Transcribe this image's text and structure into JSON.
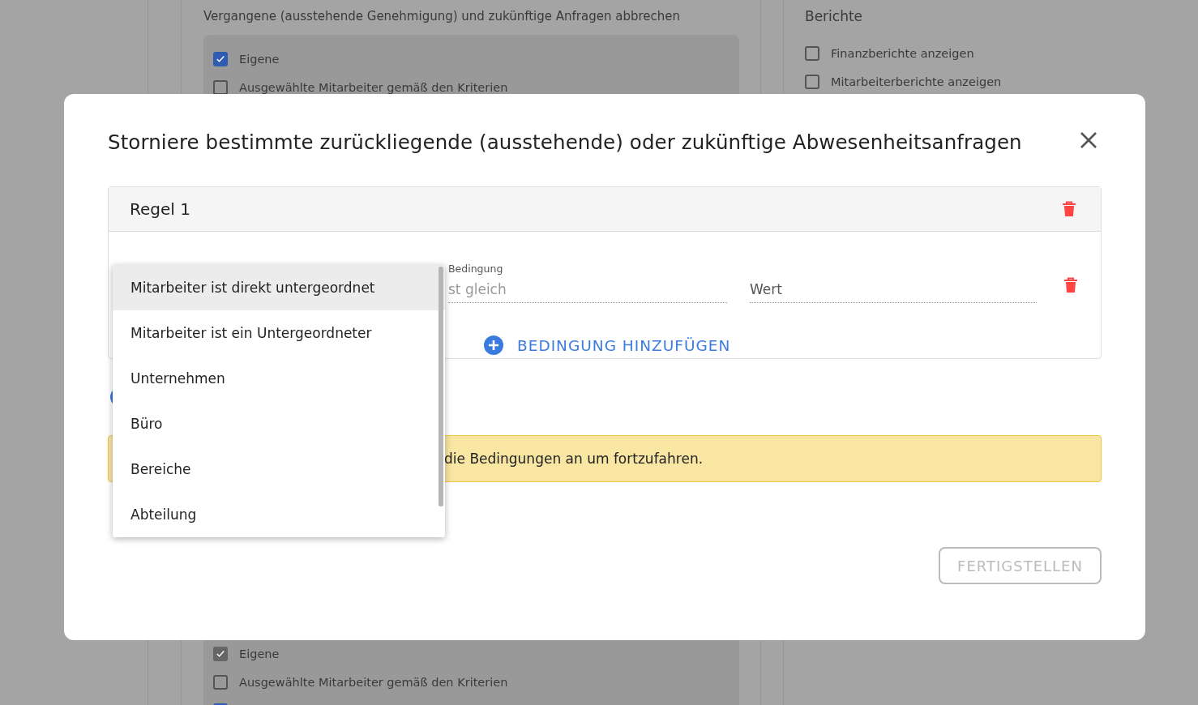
{
  "background": {
    "permissions": {
      "title": "Vergangene (ausstehende Genehmigung) und zukünftige Anfragen abbrechen",
      "options": [
        {
          "label": "Eigene",
          "checked": true,
          "disabled": false
        },
        {
          "label": "Ausgewählte Mitarbeiter gemäß den Kriterien",
          "checked": false,
          "disabled": false
        }
      ]
    },
    "reports": {
      "title": "Berichte",
      "options": [
        {
          "label": "Finanzberichte anzeigen",
          "checked": false
        },
        {
          "label": "Mitarbeiterberichte anzeigen",
          "checked": false
        }
      ]
    },
    "lower_options": [
      {
        "label": "Eigene",
        "checked": true,
        "disabled": true
      },
      {
        "label": "Ausgewählte Mitarbeiter gemäß den Kriterien",
        "checked": false,
        "disabled": false
      },
      {
        "checked": true,
        "disabled": false
      }
    ]
  },
  "dialog": {
    "title": "Storniere bestimmte zurückliegende (ausstehende) oder zukünftige Abwesenheitsanfragen",
    "rules": [
      {
        "title": "Regel 1",
        "conditions": [
          {
            "condition_label": "Bedingung",
            "condition_value": "st gleich",
            "value_placeholder": "Wert"
          }
        ],
        "add_condition": "BEDINGUNG HINZUFÜGEN"
      }
    ],
    "warning": "die Bedingungen an um fortzufahren.",
    "finish_button": {
      "label": "FERTIGSTELLEN",
      "disabled": true
    },
    "filter_menu": [
      {
        "label": "Mitarbeiter ist direkt untergeordnet",
        "selected": true
      },
      {
        "label": "Mitarbeiter ist ein Untergeordneter",
        "selected": false
      },
      {
        "label": "Unternehmen",
        "selected": false
      },
      {
        "label": "Büro",
        "selected": false
      },
      {
        "label": "Bereiche",
        "selected": false
      },
      {
        "label": "Abteilung",
        "selected": false
      }
    ]
  }
}
